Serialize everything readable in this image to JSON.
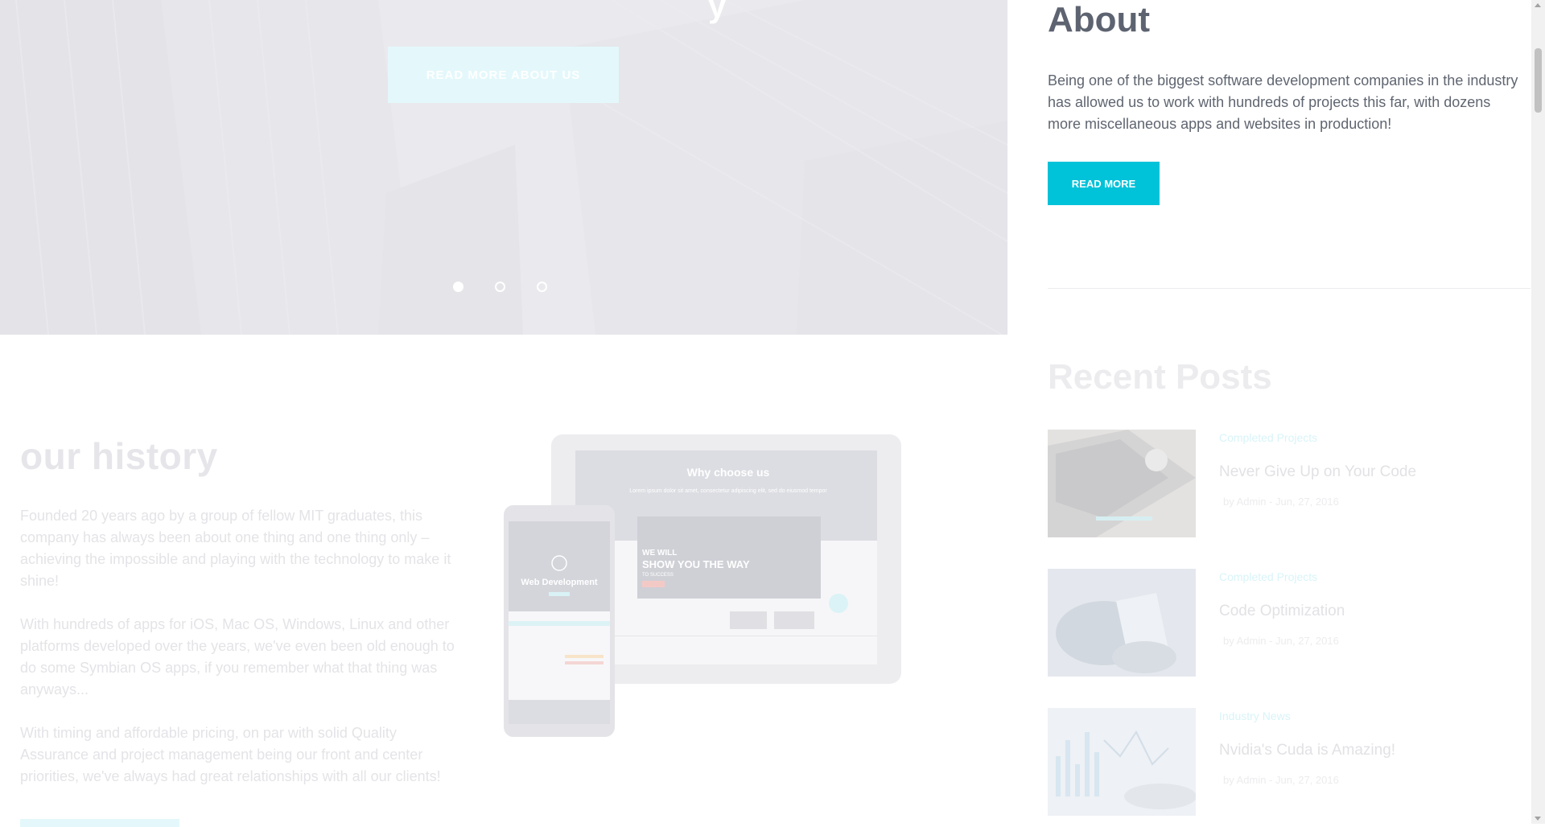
{
  "hero": {
    "title_fragment": "y",
    "button_label": "READ MORE ABOUT US",
    "slides": [
      "slide-1",
      "slide-2",
      "slide-3"
    ],
    "active_slide": 0
  },
  "history": {
    "title": "our history",
    "paragraphs": [
      "Founded 20 years ago by a group of fellow MIT graduates, this company has always been about one thing and one thing only – achieving the impossible and playing with the technology to make it shine!",
      "With hundreds of apps for iOS, Mac OS, Windows, Linux and other platforms developed over the years, we've even been old enough to do some Symbian OS apps, if you remember what that thing was anyways...",
      "With timing and affordable pricing, on par with solid Quality Assurance and project management being our front and center priorities, we've always had great relationships with all our clients!"
    ]
  },
  "devices": {
    "tablet_heading": "Why choose us",
    "tablet_sub": "Lorem ipsum dolor sit amet, consectetur adipiscing elit, sed do eiusmod tempor",
    "tablet_hero_line1": "WE WILL",
    "tablet_hero_line2": "SHOW YOU THE WAY",
    "tablet_hero_line3": "TO SUCCESS",
    "phone_heading": "Web Development"
  },
  "about": {
    "title": "About",
    "text": "Being one of the biggest software development companies in the industry has allowed us to work with hundreds of projects this far, with dozens more miscellaneous apps and websites in production!",
    "button_label": "READ MORE"
  },
  "recent": {
    "title": "Recent Posts",
    "posts": [
      {
        "category": "Completed Projects",
        "title": "Never Give Up on Your Code",
        "meta": "by Admin - Jun, 27, 2016"
      },
      {
        "category": "Completed Projects",
        "title": "Code Optimization",
        "meta": "by Admin - Jun, 27, 2016"
      },
      {
        "category": "Industry News",
        "title": "Nvidia's Cuda is Amazing!",
        "meta": "by Admin - Jun, 27, 2016"
      }
    ]
  },
  "colors": {
    "accent": "#00c2d9",
    "heading": "#5d6370",
    "text": "#5f6570"
  }
}
